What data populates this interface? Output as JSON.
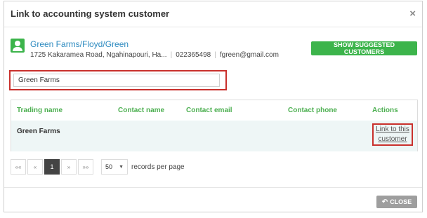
{
  "dialog": {
    "title": "Link to accounting system customer",
    "close_icon": "×"
  },
  "customer": {
    "name": "Green Farms/Floyd/Green",
    "address": "1725 Kakaramea Road, Ngahinapouri, Ha...",
    "phone": "022365498",
    "email": "fgreen@gmail.com",
    "icon": "user-icon"
  },
  "suggest_button": "SHOW SUGGESTED CUSTOMERS",
  "search": {
    "value": "Green Farms",
    "placeholder": ""
  },
  "table": {
    "headers": [
      "Trading name",
      "Contact name",
      "Contact email",
      "Contact phone",
      "Actions"
    ],
    "rows": [
      {
        "trading_name": "Green Farms",
        "contact_name": "",
        "contact_email": "",
        "contact_phone": "",
        "action_label": "Link to this customer"
      }
    ]
  },
  "pagination": {
    "first": "««",
    "prev": "«",
    "current": "1",
    "next": "»",
    "last": "»»",
    "per_page": "50",
    "per_page_label": "records per page"
  },
  "footer": {
    "close_label": "CLOSE"
  },
  "colors": {
    "accent_green": "#3cb44b",
    "link_blue": "#2e8bc0",
    "highlight_red": "#c9302c",
    "row_bg": "#eef6f6"
  }
}
